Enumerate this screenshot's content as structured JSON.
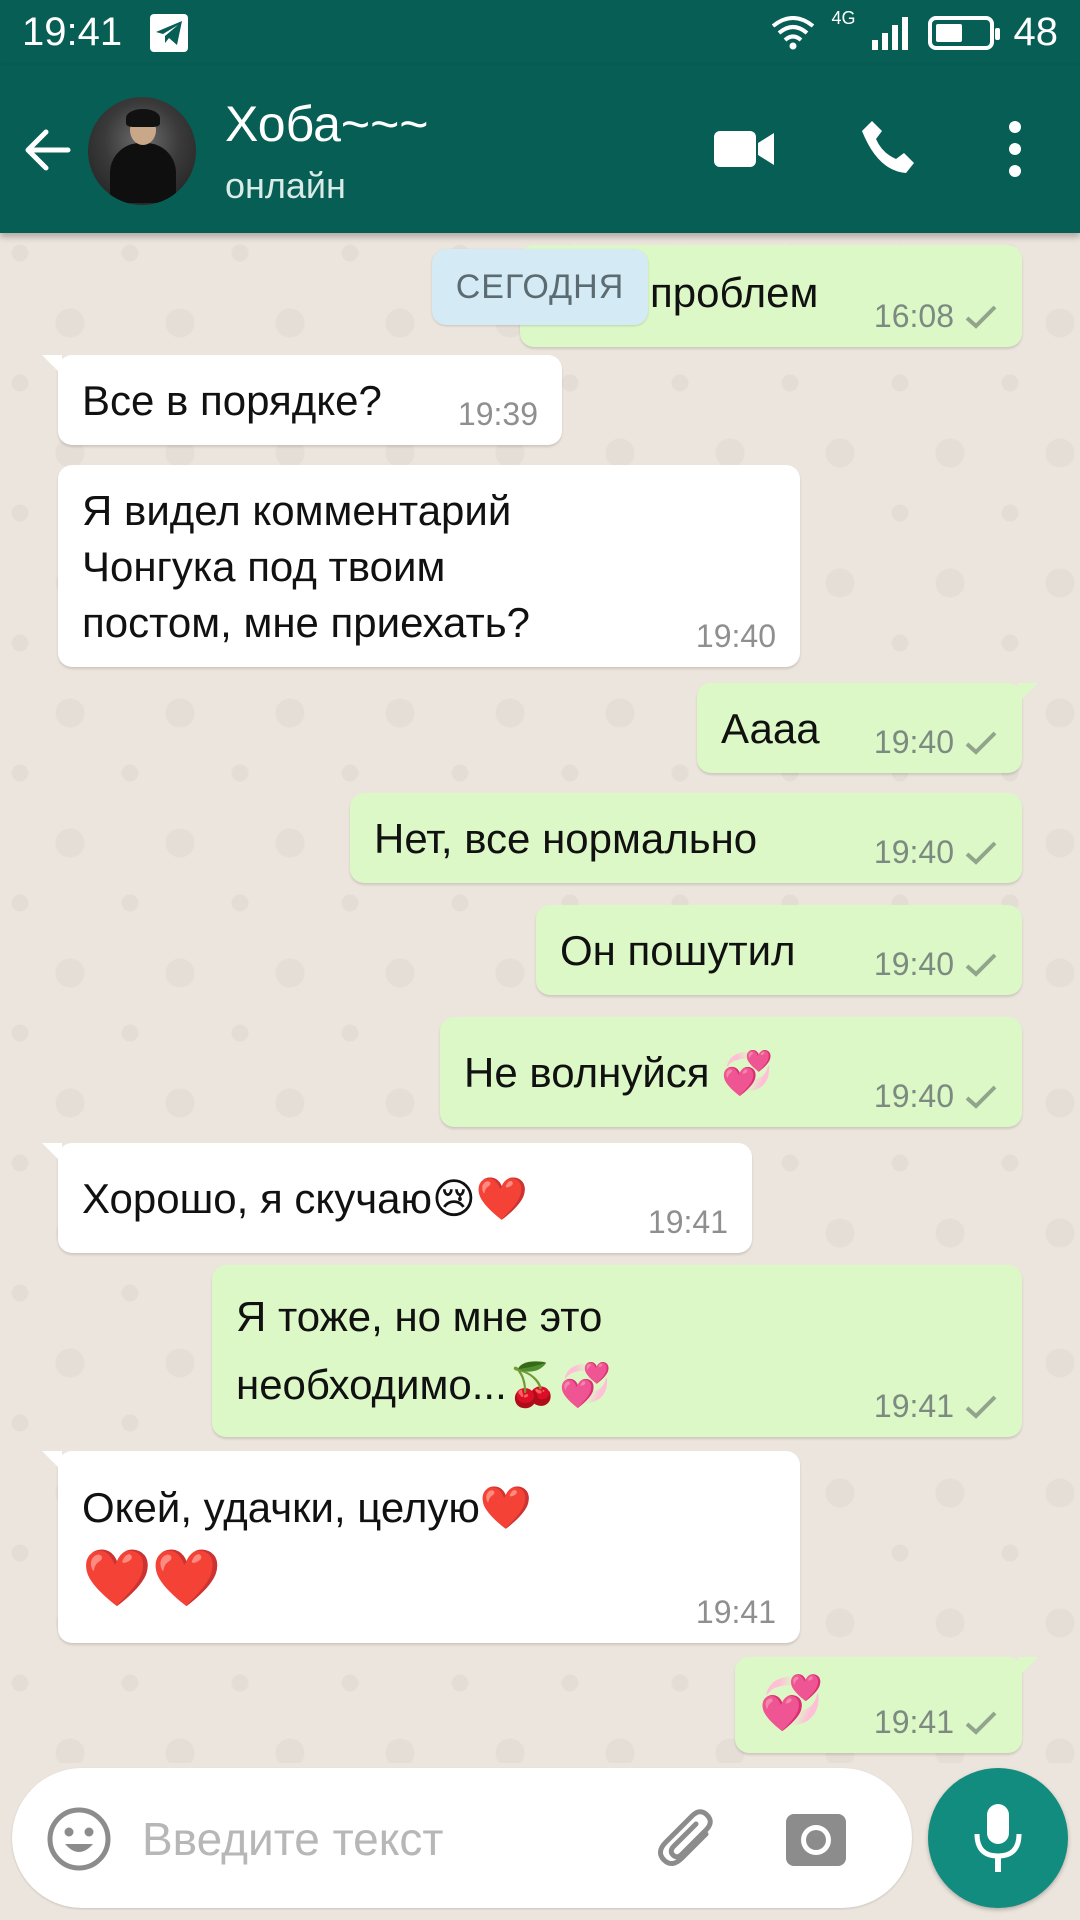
{
  "status_bar": {
    "time": "19:41",
    "network": "4G",
    "battery": "48"
  },
  "header": {
    "contact_name": "Хоба~~~",
    "contact_status": "онлайн"
  },
  "chat": {
    "date_label": "СЕГОДНЯ",
    "messages": [
      {
        "direction": "out",
        "text": "Без проблем",
        "visible_text": "проблем",
        "time": "16:08"
      },
      {
        "direction": "in",
        "text": "Все в порядке?",
        "time": "19:39"
      },
      {
        "direction": "in",
        "lines": [
          "Я видел комментарий",
          "Чонгука под твоим",
          "постом, мне приехать?"
        ],
        "time": "19:40"
      },
      {
        "direction": "out",
        "text": "Аааа",
        "time": "19:40"
      },
      {
        "direction": "out",
        "text": "Нет, все нормально",
        "time": "19:40"
      },
      {
        "direction": "out",
        "text": "Он пошутил",
        "time": "19:40"
      },
      {
        "direction": "out",
        "text": "Не волнуйся 💞",
        "time": "19:40"
      },
      {
        "direction": "in",
        "text": "Хорошо, я скучаю😢❤️",
        "time": "19:41"
      },
      {
        "direction": "out",
        "lines": [
          "Я тоже, но мне это",
          "необходимо...🍒💞"
        ],
        "time": "19:41"
      },
      {
        "direction": "in",
        "lines": [
          "Окей, удачки, целую❤️",
          "❤️❤️"
        ],
        "time": "19:41"
      },
      {
        "direction": "out",
        "text": "💞",
        "time": "19:41"
      }
    ]
  },
  "input": {
    "placeholder": "Введите текст"
  },
  "icons": {
    "back": "arrow-left-icon",
    "video": "video-camera-icon",
    "call": "phone-icon",
    "menu": "more-vertical-icon",
    "emoji": "smile-icon",
    "attach": "paperclip-icon",
    "camera": "camera-icon",
    "mic": "microphone-icon",
    "check": "single-check-icon"
  },
  "colors": {
    "header": "#075e54",
    "outgoing_bubble": "#dcf8c6",
    "incoming_bubble": "#ffffff",
    "chat_background": "#ece5dd",
    "mic_button": "#128c7e",
    "date_chip": "#d4eaf4"
  }
}
